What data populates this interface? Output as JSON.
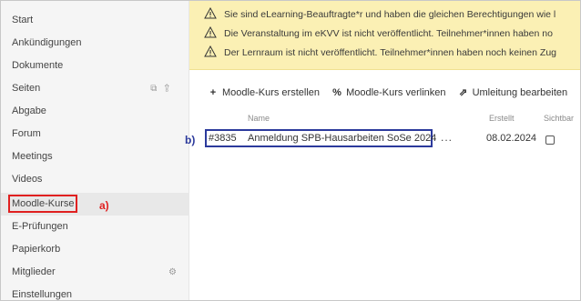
{
  "sidebar": {
    "items": [
      {
        "label": "Start"
      },
      {
        "label": "Ankündigungen"
      },
      {
        "label": "Dokumente"
      },
      {
        "label": "Seiten"
      },
      {
        "label": "Abgabe"
      },
      {
        "label": "Forum"
      },
      {
        "label": "Meetings"
      },
      {
        "label": "Videos"
      },
      {
        "label": "Moodle-Kurse"
      },
      {
        "label": "E-Prüfungen"
      },
      {
        "label": "Papierkorb"
      },
      {
        "label": "Mitglieder"
      },
      {
        "label": "Einstellungen"
      }
    ],
    "active_item": "Moodle-Kurse"
  },
  "annotations": {
    "a": "a)",
    "b": "b)",
    "a_color": "#e02020",
    "b_color": "#2c3a9c"
  },
  "banner": {
    "background": "#fbf0b4",
    "warnings": [
      {
        "icon": "warning-icon",
        "text": "Sie sind eLearning-Beauftragte*r und haben die gleichen Berechtigungen wie l"
      },
      {
        "icon": "warning-icon",
        "text": "Die Veranstaltung im eKVV ist nicht veröffentlicht. Teilnehmer*innen haben no"
      },
      {
        "icon": "warning-icon",
        "text": "Der Lernraum ist nicht veröffentlicht. Teilnehmer*innen haben noch keinen Zug"
      }
    ]
  },
  "toolbar": {
    "create_label": "Moodle-Kurs erstellen",
    "create_icon": "plus-icon",
    "link_label": "Moodle-Kurs verlinken",
    "link_icon": "link-icon",
    "redirect_label": "Umleitung bearbeiten",
    "redirect_icon": "external-link-icon"
  },
  "table": {
    "headers": {
      "name": "Name",
      "created": "Erstellt",
      "visible": "Sichtbar"
    },
    "rows": [
      {
        "id": "#3835",
        "name": "Anmeldung SPB-Hausarbeiten SoSe 2024",
        "menu": "...",
        "created": "08.02.2024",
        "visible": false
      }
    ]
  }
}
